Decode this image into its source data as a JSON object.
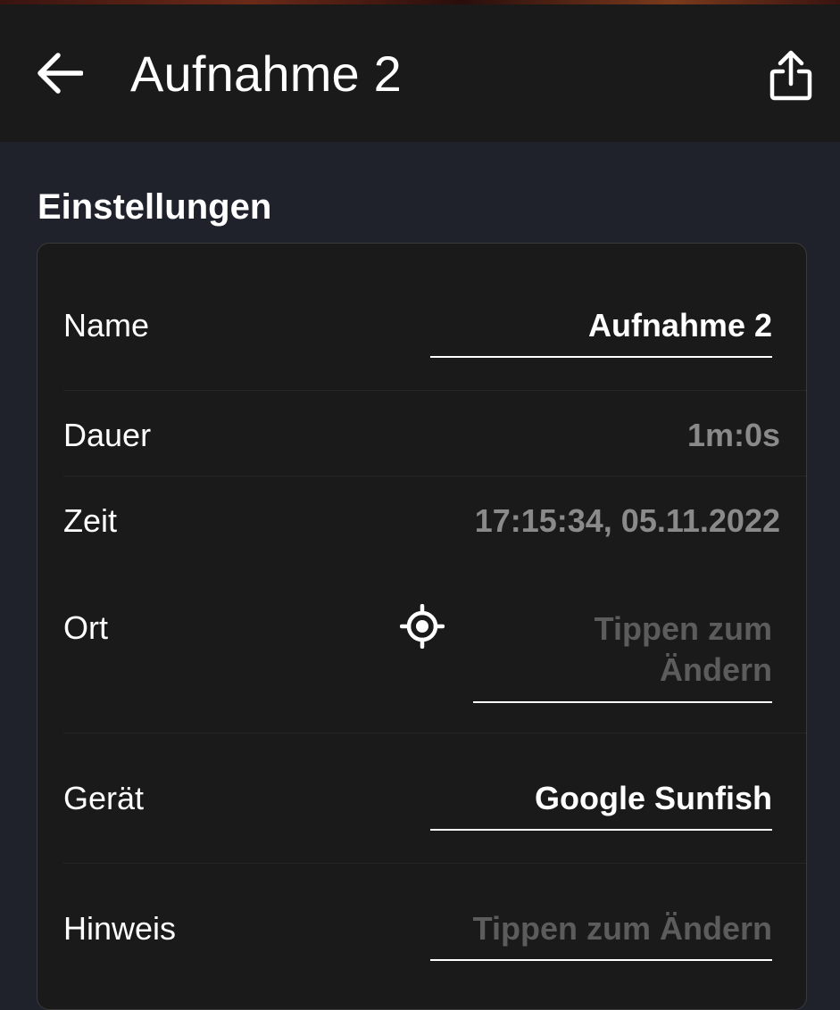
{
  "header": {
    "title": "Aufnahme 2",
    "back_icon": "arrow-left-icon",
    "share_icon": "share-icon"
  },
  "section": {
    "title": "Einstellungen"
  },
  "settings": {
    "name": {
      "label": "Name",
      "value": "Aufnahme 2"
    },
    "duration": {
      "label": "Dauer",
      "value": "1m:0s"
    },
    "time": {
      "label": "Zeit",
      "value": "17:15:34, 05.11.2022"
    },
    "location": {
      "label": "Ort",
      "placeholder_line1": "Tippen zum",
      "placeholder_line2": "Ändern",
      "icon": "gps-locate-icon"
    },
    "device": {
      "label": "Gerät",
      "value": "Google Sunfish"
    },
    "note": {
      "label": "Hinweis",
      "placeholder": "Tippen zum Ändern"
    }
  },
  "colors": {
    "background": "#1f222b",
    "surface": "#1a1a1a",
    "text_primary": "#ffffff",
    "text_secondary": "#8a8a8a",
    "text_placeholder": "#5c5c5c"
  }
}
